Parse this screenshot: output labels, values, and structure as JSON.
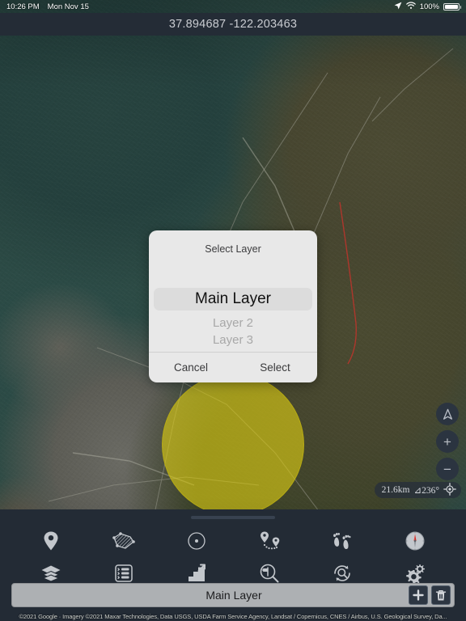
{
  "status_bar": {
    "time": "10:26 PM",
    "date": "Mon Nov 15",
    "location_icon": "location-arrow-icon",
    "wifi_icon": "wifi-icon",
    "battery_percent": "100%",
    "battery_icon": "battery-full-icon"
  },
  "header": {
    "coordinates": "37.894687 -122.203463"
  },
  "map": {
    "controls": [
      {
        "name": "compass-north-button",
        "glyph": "▲"
      },
      {
        "name": "zoom-in-button",
        "glyph": "+"
      },
      {
        "name": "zoom-out-button",
        "glyph": "−"
      }
    ],
    "scale": {
      "distance": "21.6km",
      "bearing": "⊿236°",
      "target_icon": "crosshair-target-icon"
    },
    "overlay_circle_color": "#decе14"
  },
  "dialog": {
    "title": "Select Layer",
    "options": [
      {
        "label": "Main Layer",
        "selected": true
      },
      {
        "label": "Layer 2",
        "selected": false
      },
      {
        "label": "Layer 3",
        "selected": false
      }
    ],
    "cancel_label": "Cancel",
    "confirm_label": "Select"
  },
  "toolbar": {
    "row1": [
      {
        "name": "marker-pin-tool",
        "label": "Marker"
      },
      {
        "name": "polygon-shape-tool",
        "label": "Polygon"
      },
      {
        "name": "circle-radius-tool",
        "label": "Circle"
      },
      {
        "name": "route-path-tool",
        "label": "Route"
      },
      {
        "name": "footprints-track-tool",
        "label": "Track"
      },
      {
        "name": "compass-tool",
        "label": "Compass"
      }
    ],
    "row2": [
      {
        "name": "layers-tool",
        "label": "Layers"
      },
      {
        "name": "list-view-tool",
        "label": "List"
      },
      {
        "name": "elevation-profile-tool",
        "label": "Elevation"
      },
      {
        "name": "search-place-tool",
        "label": "Search Place"
      },
      {
        "name": "search-refresh-tool",
        "label": "Refresh Search"
      },
      {
        "name": "settings-gears-tool",
        "label": "Settings"
      }
    ]
  },
  "layer_bar": {
    "current_layer": "Main Layer",
    "add_button_icon": "plus-icon",
    "delete_button_icon": "trash-icon"
  },
  "attribution": {
    "text": "©2021 Google · Imagery ©2021 Maxar Technologies, Data USGS, USDA Farm Service Agency, Landsat / Copernicus, CNES / Airbus, U.S. Geological Survey, Da..."
  }
}
